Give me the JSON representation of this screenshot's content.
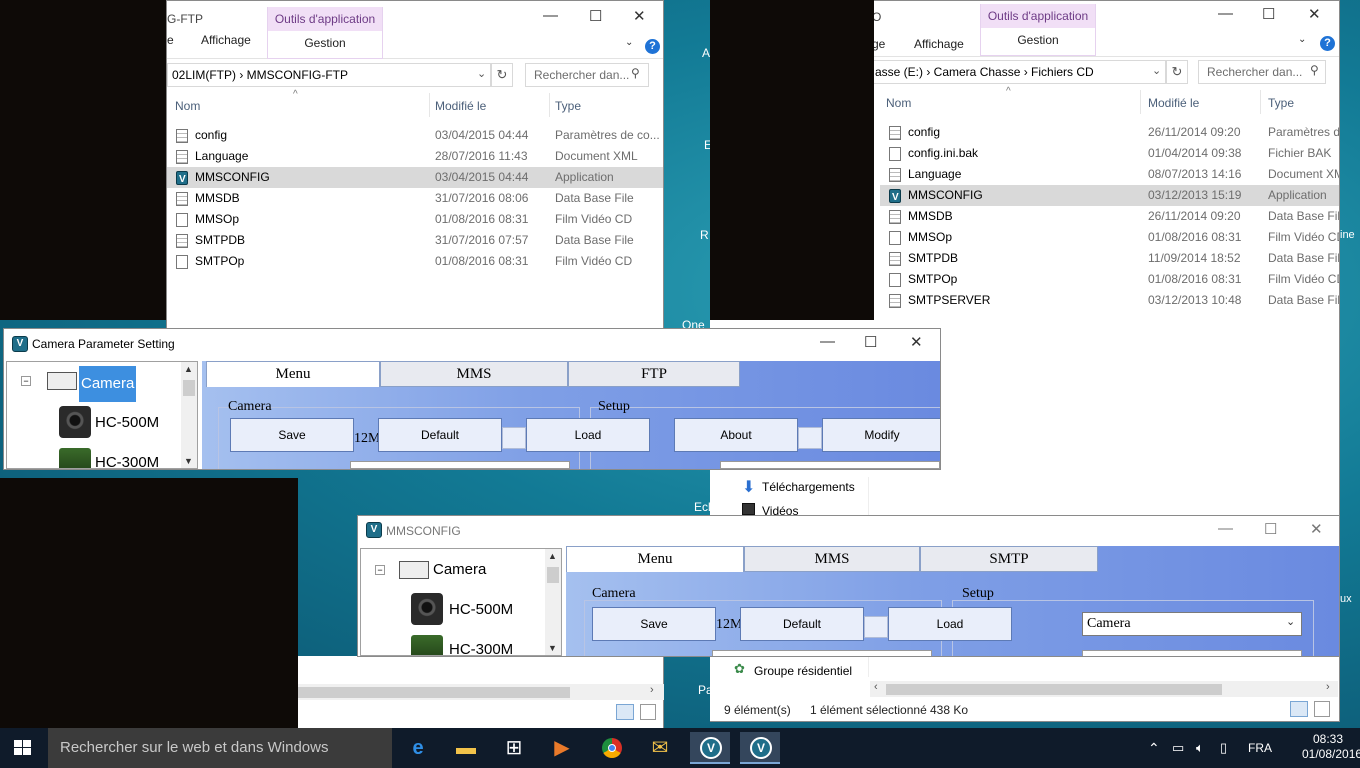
{
  "explorer_left": {
    "title_partial": "02LIM(FTP) › MMSCONFIG-FTP",
    "window_title": "G-FTP",
    "ribbon": {
      "tab_file": "e",
      "tab_view": "Affichage",
      "context_header": "Outils d'application",
      "context_tab": "Gestion"
    },
    "address": "02LIM(FTP)   ›   MMSCONFIG-FTP",
    "search_placeholder": "Rechercher dan...",
    "columns": {
      "name": "Nom",
      "modified": "Modifié le",
      "type": "Type"
    },
    "rows": [
      {
        "name": "config",
        "date": "03/04/2015 04:44",
        "type": "Paramètres de co...",
        "icon": "settings-file-icon"
      },
      {
        "name": "Language",
        "date": "28/07/2016 11:43",
        "type": "Document XML",
        "icon": "xml-file-icon"
      },
      {
        "name": "MMSCONFIG",
        "date": "03/04/2015 04:44",
        "type": "Application",
        "icon": "app-icon"
      },
      {
        "name": "MMSDB",
        "date": "31/07/2016 08:06",
        "type": "Data Base File",
        "icon": "db-file-icon"
      },
      {
        "name": "MMSOp",
        "date": "01/08/2016 08:31",
        "type": "Film Vidéo CD",
        "icon": "file-icon"
      },
      {
        "name": "SMTPDB",
        "date": "31/07/2016 07:57",
        "type": "Data Base File",
        "icon": "db-file-icon"
      },
      {
        "name": "SMTPOp",
        "date": "01/08/2016 08:31",
        "type": "Film Vidéo CD",
        "icon": "file-icon"
      }
    ]
  },
  "explorer_right": {
    "ribbon": {
      "tab_file": "ge",
      "tab_view": "Affichage",
      "context_header": "Outils d'application",
      "context_tab": "Gestion"
    },
    "title_fragment": "O",
    "address": "asse (E:)   ›   Camera Chasse   ›   Fichiers CD",
    "search_placeholder": "Rechercher dan...",
    "columns": {
      "name": "Nom",
      "modified": "Modifié le",
      "type": "Type"
    },
    "rows": [
      {
        "name": "config",
        "date": "26/11/2014 09:20",
        "type": "Paramètres d",
        "icon": "settings-file-icon"
      },
      {
        "name": "config.ini.bak",
        "date": "01/04/2014 09:38",
        "type": "Fichier BAK",
        "icon": "file-icon"
      },
      {
        "name": "Language",
        "date": "08/07/2013 14:16",
        "type": "Document XM",
        "icon": "xml-file-icon"
      },
      {
        "name": "MMSCONFIG",
        "date": "03/12/2013 15:19",
        "type": "Application",
        "icon": "app-icon"
      },
      {
        "name": "MMSDB",
        "date": "26/11/2014 09:20",
        "type": "Data Base File",
        "icon": "db-file-icon"
      },
      {
        "name": "MMSOp",
        "date": "01/08/2016 08:31",
        "type": "Film Vidéo CD",
        "icon": "file-icon"
      },
      {
        "name": "SMTPDB",
        "date": "11/09/2014 18:52",
        "type": "Data Base File",
        "icon": "db-file-icon"
      },
      {
        "name": "SMTPOp",
        "date": "01/08/2016 08:31",
        "type": "Film Vidéo CD",
        "icon": "file-icon"
      },
      {
        "name": "SMTPSERVER",
        "date": "03/12/2013 10:48",
        "type": "Data Base File",
        "icon": "db-file-icon"
      }
    ],
    "nav": {
      "downloads": "Téléchargements",
      "videos": "Vidéos",
      "homegroup": "Groupe résidentiel"
    },
    "status": {
      "count": "9 élément(s)",
      "selected": "1 élément sélectionné",
      "size": "438 Ko"
    }
  },
  "camera_param": {
    "title": "Camera Parameter Setting",
    "tree": {
      "root": "Camera",
      "items": [
        "HC-500M",
        "HC-300M"
      ]
    },
    "tabs": [
      "Menu",
      "MMS",
      "FTP"
    ],
    "group_camera": "Camera",
    "group_setup": "Setup",
    "buttons": {
      "save": "Save",
      "default": "Default",
      "load": "Load",
      "about": "About",
      "modify": "Modify"
    },
    "text_12m": "12M"
  },
  "mmsconfig": {
    "title": "MMSCONFIG",
    "tree": {
      "root": "Camera",
      "items": [
        "HC-500M",
        "HC-300M"
      ]
    },
    "tabs": [
      "Menu",
      "MMS",
      "SMTP"
    ],
    "group_camera": "Camera",
    "group_setup": "Setup",
    "buttons": {
      "save": "Save",
      "default": "Default",
      "load": "Load"
    },
    "text_12m": "12M",
    "combo_value": "Camera"
  },
  "desktop_fragments": {
    "a": "A",
    "e": "E",
    "r": "R",
    "one": "One",
    "ecl": "Ecl",
    "pa": "Pa",
    "ux": "ux",
    "ine": "ine"
  },
  "taskbar": {
    "search_placeholder": "Rechercher sur le web et dans Windows",
    "lang": "FRA",
    "time": "08:33",
    "date": "01/08/2016"
  },
  "colors": {
    "taskbar": "#0f1b2a",
    "ribbon_context": "#f1dff6",
    "pane_blue": "#7f9fe6",
    "selection": "#d9d9d9",
    "tree_selected": "#3d8fe0"
  }
}
